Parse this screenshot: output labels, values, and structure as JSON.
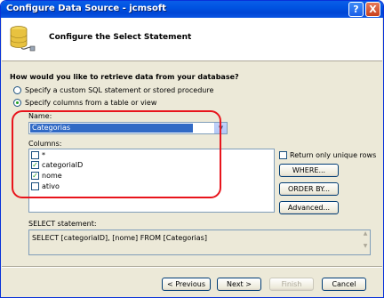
{
  "window": {
    "title": "Configure Data Source - jcmsoft",
    "help_label": "?",
    "close_label": "X"
  },
  "header": {
    "title": "Configure the Select Statement"
  },
  "question": "How would you like to retrieve data from your database?",
  "options": {
    "custom_sql": "Specify a custom SQL statement or stored procedure",
    "columns_from_table": "Specify columns from a table or view",
    "selected": "columns_from_table"
  },
  "name_field": {
    "label": "Name:",
    "value": "Categorias"
  },
  "columns": {
    "label": "Columns:",
    "items": [
      {
        "label": "*",
        "checked": false
      },
      {
        "label": "categoriaID",
        "checked": true
      },
      {
        "label": "nome",
        "checked": true
      },
      {
        "label": "ativo",
        "checked": false
      }
    ]
  },
  "unique_rows": {
    "label": "Return only unique rows",
    "checked": false
  },
  "side_buttons": {
    "where": "WHERE...",
    "order_by": "ORDER BY...",
    "advanced": "Advanced..."
  },
  "select_statement": {
    "label": "SELECT statement:",
    "text": "SELECT [categoriaID], [nome] FROM [Categorias]"
  },
  "footer": {
    "previous": "< Previous",
    "next": "Next >",
    "finish": "Finish",
    "cancel": "Cancel"
  },
  "colors": {
    "titlebar": "#0054e3",
    "selection": "#316ac5",
    "highlight_outline": "#e8141c",
    "dialog_bg": "#ece9d8"
  },
  "icons": {
    "header_icon": "database-connection-icon",
    "combo_arrow": "chevron-down-icon"
  }
}
